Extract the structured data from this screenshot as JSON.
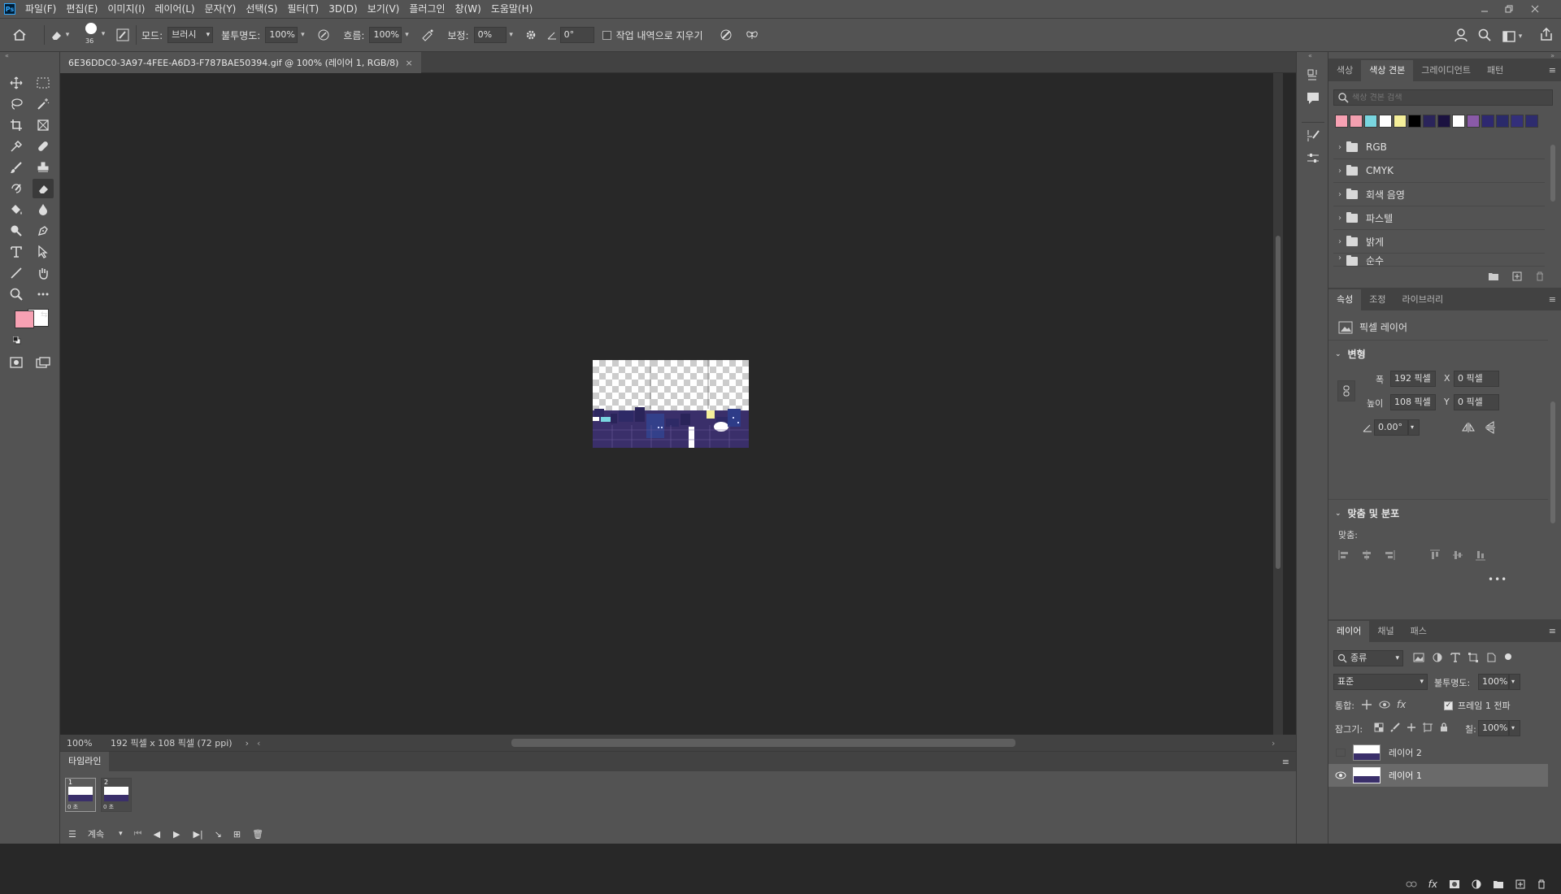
{
  "menubar": {
    "logo": "Ps",
    "items": [
      "파일(F)",
      "편집(E)",
      "이미지(I)",
      "레이어(L)",
      "문자(Y)",
      "선택(S)",
      "필터(T)",
      "3D(D)",
      "보기(V)",
      "플러그인",
      "창(W)",
      "도움말(H)"
    ]
  },
  "options": {
    "brush_size": "36",
    "mode_label": "모드:",
    "mode_value": "브러시",
    "opacity_label": "불투명도:",
    "opacity_value": "100%",
    "flow_label": "흐름:",
    "flow_value": "100%",
    "smoothing_label": "보정:",
    "smoothing_value": "0%",
    "angle_value": "0°",
    "erase_history_label": "작업 내역으로 지우기"
  },
  "document": {
    "tab_title": "6E36DDC0-3A97-4FEE-A6D3-F787BAE50394.gif @ 100% (레이어 1, RGB/8)",
    "zoom": "100%",
    "doc_info": "192 픽셀 x 108 픽셀 (72 ppi)"
  },
  "timeline": {
    "title": "타임라인",
    "frames": [
      {
        "number": "1",
        "delay": "0 초"
      },
      {
        "number": "2",
        "delay": "0 초"
      }
    ],
    "loop": "계속"
  },
  "swatches": {
    "tabs": [
      "색상",
      "색상 견본",
      "그레이디언트",
      "패턴"
    ],
    "search_placeholder": "색상 견본 검색",
    "colors": [
      "#f7a1b3",
      "#f3a0b0",
      "#79d6e0",
      "#ffffff",
      "#f5ef9a",
      "#000000",
      "#2a245a",
      "#1b1240",
      "#ffffff",
      "#8a5aa8",
      "#2e2870",
      "#2a2a6a",
      "#332f7a",
      "#2e2c6e"
    ],
    "groups": [
      "RGB",
      "CMYK",
      "회색 음영",
      "파스텔",
      "밝게",
      "순수"
    ]
  },
  "properties": {
    "tabs": [
      "속성",
      "조정",
      "라이브러리"
    ],
    "layer_type": "픽셀 레이어",
    "transform_title": "변형",
    "width_label": "폭",
    "width_value": "192 픽셀",
    "height_label": "높이",
    "height_value": "108 픽셀",
    "x_label": "X",
    "x_value": "0 픽셀",
    "y_label": "Y",
    "y_value": "0 픽셀",
    "angle_value": "0.00°",
    "align_title": "맞춤 및 분포",
    "align_label": "맞춤:"
  },
  "layers": {
    "tabs": [
      "레이어",
      "채널",
      "패스"
    ],
    "filter_label": "종류",
    "blend_mode": "표준",
    "opacity_label": "불투명도:",
    "opacity_value": "100%",
    "unify_label": "통합:",
    "propagate_label": "프레임 1 전파",
    "lock_label": "잠그기:",
    "fill_label": "칠:",
    "fill_value": "100%",
    "items": [
      {
        "name": "레이어 2",
        "visible": false
      },
      {
        "name": "레이어 1",
        "visible": true
      }
    ]
  },
  "colors": {
    "foreground": "#f7a1b3",
    "background": "#ffffff"
  }
}
